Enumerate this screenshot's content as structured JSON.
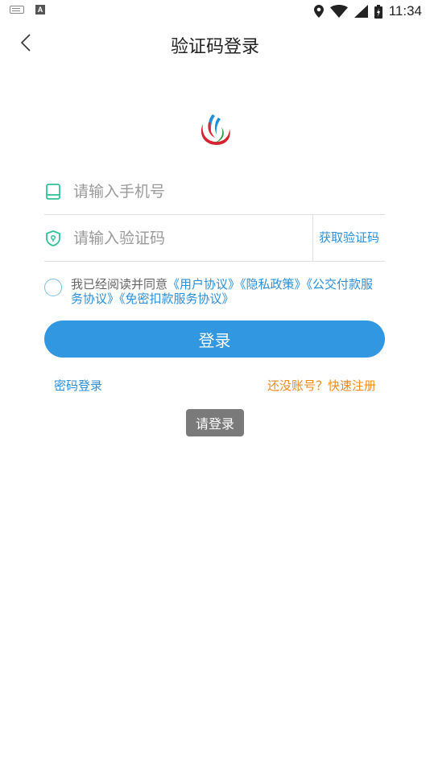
{
  "status_bar": {
    "time": "11:34"
  },
  "header": {
    "title": "验证码登录"
  },
  "form": {
    "phone_placeholder": "请输入手机号",
    "phone_value": "",
    "code_placeholder": "请输入验证码",
    "code_value": "",
    "get_code_label": "获取验证码"
  },
  "agreement": {
    "prefix": "我已经阅读并同意",
    "links": [
      "《用户协议》",
      "《隐私政策》",
      "《公交付款服务协议》",
      "《免密扣款服务协议》"
    ]
  },
  "actions": {
    "login_label": "登录",
    "password_login": "密码登录",
    "register": "还没账号？快速注册"
  },
  "toast": {
    "message": "请登录"
  },
  "colors": {
    "primary": "#3097e0",
    "link": "#2b8fdc",
    "accent": "#f08a1c",
    "field_icon": "#2fc39a"
  },
  "icons": [
    "keyboard-icon",
    "a-icon",
    "location-icon",
    "wifi-icon",
    "signal-icon",
    "battery-icon",
    "back-arrow-icon",
    "app-logo",
    "phone-icon",
    "shield-icon"
  ]
}
